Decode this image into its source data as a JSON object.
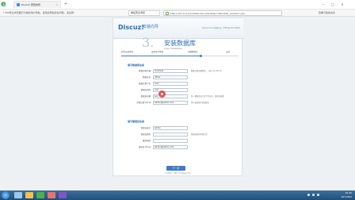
{
  "browser": {
    "tab_title": "Discuz! 安装向导",
    "tab_close": "×",
    "new_tab": "+",
    "url": "http://127.0.0.1/install/index.php?step=3&install_ucenter=yes",
    "notice_text": "360安全浏览器已为保护用户隐私，发现此网站存在风险，请注意!",
    "notice_link": "前往安全浏览",
    "nav_right_1": "查看与我的关系",
    "window_buttons": [
      "─",
      "□",
      "×"
    ]
  },
  "installer": {
    "logo": "Discuz!",
    "logo_sub": "安装向导",
    "version": "Discuz! X3.4 简体中文 UTF8 版 20170801",
    "step_number": "3.",
    "step_title": "安装数据库",
    "step_subtitle": "Copy Database",
    "progress": {
      "steps": [
        "检查安装环境",
        "设置运行环境",
        "创建数据库",
        "安装"
      ],
      "fraction": 0.68
    },
    "section_db": "填写数据库信息",
    "db_rows": [
      {
        "label": "数据库服务器:",
        "value": "localhost",
        "hint": "数据库服务器地址，一般为 localhost"
      },
      {
        "label": "数据库名:",
        "value": "ultrax",
        "hint": ""
      },
      {
        "label": "数据库用户名:",
        "value": "root",
        "hint": ""
      },
      {
        "label": "数据库密码:",
        "value": "root",
        "hint": ""
      },
      {
        "label": "数据表前缀:",
        "value": "pre_",
        "hint": "同一数据库运行多个论坛时，请修改前缀"
      },
      {
        "label": "系统信箱 Email:",
        "value": "admin@admin.com",
        "hint": "用于发送程序错误报告"
      }
    ],
    "section_admin": "填写管理员信息",
    "admin_rows": [
      {
        "label": "管理员账号:",
        "value": "admin",
        "hint": ""
      },
      {
        "label": "管理员密码:",
        "value": "",
        "hint": "管理员密码不能为空"
      },
      {
        "label": "重复密码:",
        "value": "",
        "hint": ""
      },
      {
        "label": "管理员 Email:",
        "value": "admin@admin.com",
        "hint": ""
      }
    ],
    "next_button": "下一步",
    "footer": "©2001 - 2017 Comsenz Inc."
  },
  "taskbar": {
    "time": "19:40",
    "date": "2017/8/2"
  }
}
